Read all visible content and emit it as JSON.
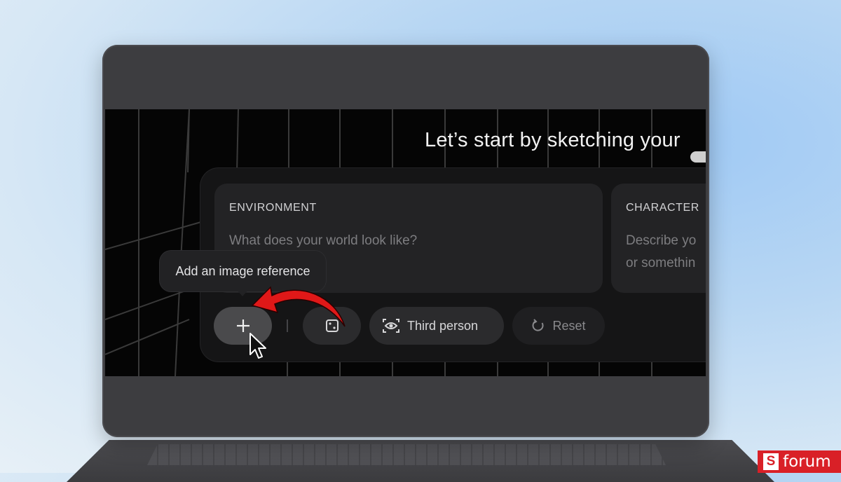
{
  "app": {
    "headline": "Let’s start by sketching your"
  },
  "cards": {
    "environment": {
      "title": "ENVIRONMENT",
      "placeholder": "What does your world look like?"
    },
    "character": {
      "title": "CHARACTER",
      "placeholder_line1": "Describe yo",
      "placeholder_line2": "or somethin"
    }
  },
  "tooltip": {
    "text": "Add an image reference"
  },
  "toolbar": {
    "add_icon": "plus-icon",
    "dice_icon": "dice-icon",
    "view_icon": "eye-scan-icon",
    "view_label": "Third person",
    "reset_icon": "refresh-icon",
    "reset_label": "Reset"
  },
  "watermark": {
    "logo_letter": "S",
    "text": "forum"
  },
  "colors": {
    "annotation_arrow": "#e01818",
    "badge": "#d92027"
  }
}
